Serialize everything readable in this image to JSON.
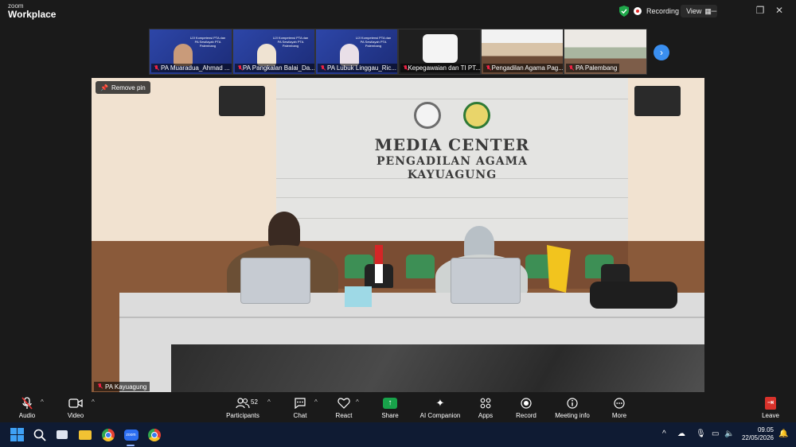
{
  "titlebar": {
    "app_small": "zoom",
    "app_name": "Workplace",
    "recording": "Recording",
    "view": "View",
    "controls": [
      "–",
      "❐",
      "✕"
    ]
  },
  "participants_strip": [
    {
      "name": "PA Muaradua_Ahmad ..."
    },
    {
      "name": "PA Pangkalan Balai_Da..."
    },
    {
      "name": "PA Lubuk Linggau_Ric..."
    },
    {
      "name": "Kepegawaian dan TI PT..."
    },
    {
      "name": "Pengadilan Agama Pag..."
    },
    {
      "name": "PA Palembang"
    }
  ],
  "slide_text": "UJI Kompetensi PTA dan PA Sewilayah PTA Palembang",
  "main_video": {
    "remove_pin": "Remove pin",
    "participant": "PA Kayuagung",
    "sign_line1": "MEDIA CENTER",
    "sign_line2": "PENGADILAN AGAMA",
    "sign_line3": "KAYUAGUNG"
  },
  "toolbar": {
    "audio": "Audio",
    "video": "Video",
    "participants": "Participants",
    "participants_count": "52",
    "chat": "Chat",
    "react": "React",
    "share": "Share",
    "ai_companion": "AI Companion",
    "apps": "Apps",
    "record": "Record",
    "meeting_info": "Meeting info",
    "more": "More",
    "leave": "Leave"
  },
  "taskbar": {
    "time": "09.05",
    "date": "22/05/2026",
    "zoom_icon_text": "zoom"
  },
  "colors": {
    "share_green": "#18a24a",
    "leave_red": "#d8322b",
    "accent_blue": "#3a8ff0"
  }
}
